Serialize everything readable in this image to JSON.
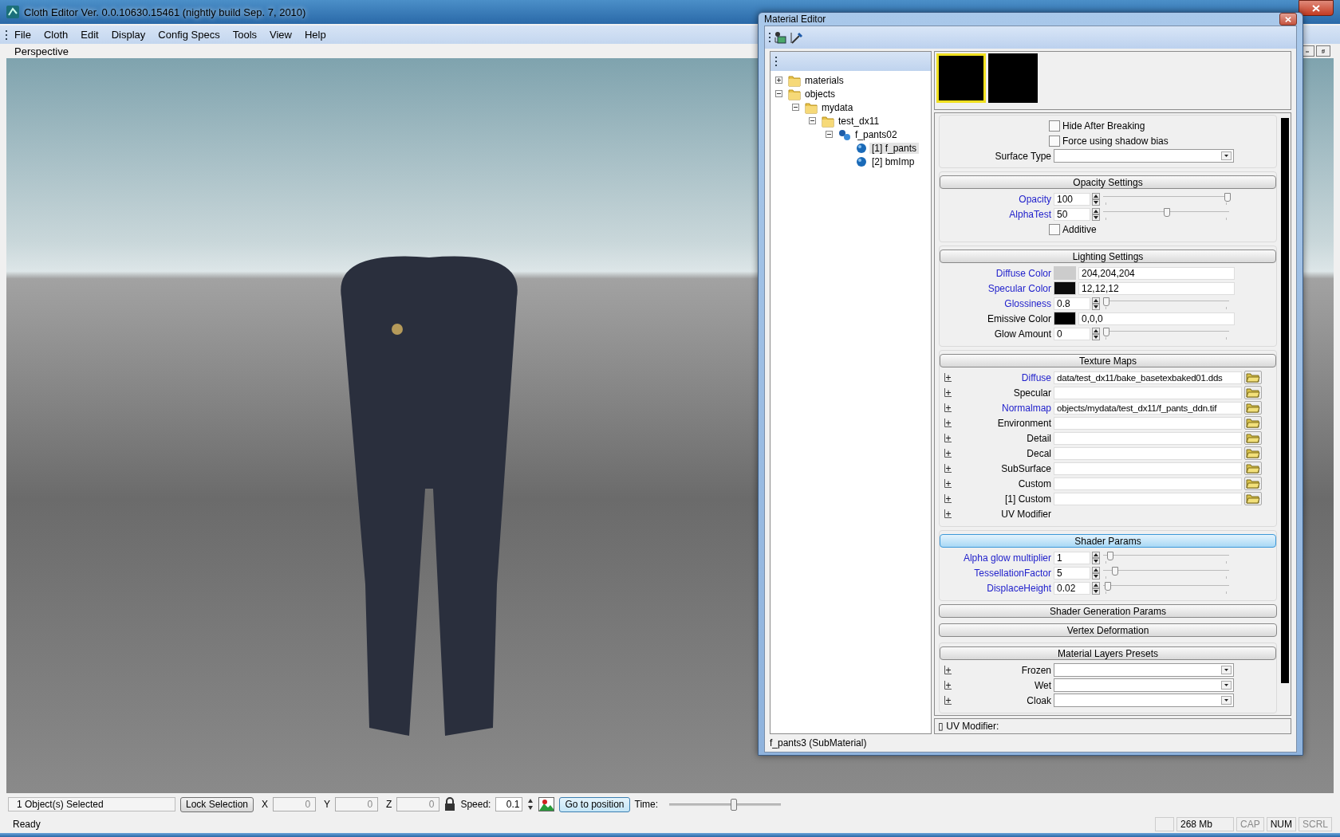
{
  "window": {
    "title": "Cloth Editor Ver. 0.0.10630.15461 (nightly build Sep. 7, 2010)"
  },
  "menu": [
    "File",
    "Cloth",
    "Edit",
    "Display",
    "Config Specs",
    "Tools",
    "View",
    "Help"
  ],
  "viewport": {
    "label": "Perspective"
  },
  "bottom_toolbar": {
    "selection": "1 Object(s) Selected",
    "lock_button": "Lock Selection",
    "coords": [
      {
        "label": "X",
        "value": "0",
        "disabled": true
      },
      {
        "label": "Y",
        "value": "0",
        "disabled": true
      },
      {
        "label": "Z",
        "value": "0",
        "disabled": true
      }
    ],
    "speed_label": "Speed:",
    "speed": "0.1",
    "goto_button": "Go to position",
    "time_label": "Time:",
    "time_slider": {
      "level": 0.57
    }
  },
  "status_bar": {
    "text": "Ready",
    "memory": "268 Mb",
    "indicators": [
      {
        "label": "CAP",
        "on": false
      },
      {
        "label": "NUM",
        "on": true
      },
      {
        "label": "SCRL",
        "on": false
      }
    ]
  },
  "material_editor": {
    "title": "Material Editor",
    "tree": [
      {
        "label": "materials",
        "kind": "folder",
        "expanded": false,
        "selected": false
      },
      {
        "label": "objects",
        "kind": "folder",
        "expanded": true,
        "selected": false,
        "children": [
          {
            "label": "mydata",
            "kind": "folder",
            "expanded": true,
            "selected": false,
            "children": [
              {
                "label": "test_dx11",
                "kind": "folder",
                "expanded": true,
                "selected": false,
                "children": [
                  {
                    "label": "f_pants02",
                    "kind": "object",
                    "expanded": true,
                    "selected": false,
                    "children": [
                      {
                        "label": "[1] f_pants",
                        "kind": "material",
                        "selected": true
                      },
                      {
                        "label": "[2] bmImp",
                        "kind": "material",
                        "selected": false
                      }
                    ]
                  }
                ]
              }
            ]
          }
        ]
      }
    ],
    "previews": [
      {
        "selected": true
      },
      {
        "selected": false
      }
    ],
    "rows": [
      {
        "kind": "checkbox",
        "label": "Hide After Breaking",
        "checked": false
      },
      {
        "kind": "checkbox",
        "label": "Force using shadow bias",
        "checked": false
      },
      {
        "kind": "combo",
        "label": "Surface Type",
        "emphasized": false
      }
    ],
    "sections": [
      {
        "title": "Opacity Settings",
        "selected": false,
        "rows": [
          {
            "kind": "spin",
            "label": "Opacity",
            "emphasized": true,
            "value": "100",
            "level": 1.0
          },
          {
            "kind": "spin",
            "label": "AlphaTest",
            "emphasized": true,
            "value": "50",
            "level": 0.5
          },
          {
            "kind": "checkbox",
            "label": "Additive",
            "checked": false
          }
        ]
      },
      {
        "title": "Lighting Settings",
        "selected": false,
        "rows": [
          {
            "kind": "color",
            "label": "Diffuse Color",
            "emphasized": true,
            "color": "#cccccc",
            "value": "204,204,204"
          },
          {
            "kind": "color",
            "label": "Specular Color",
            "emphasized": true,
            "color": "#0c0c0c",
            "value": "12,12,12"
          },
          {
            "kind": "spin",
            "label": "Glossiness",
            "emphasized": true,
            "value": "0.8",
            "level": 0.0
          },
          {
            "kind": "color",
            "label": "Emissive Color",
            "emphasized": false,
            "color": "#000000",
            "value": "0,0,0"
          },
          {
            "kind": "spin",
            "label": "Glow Amount",
            "emphasized": false,
            "value": "0",
            "level": 0.0
          }
        ]
      },
      {
        "title": "Texture Maps",
        "selected": false,
        "rows": [
          {
            "kind": "file",
            "label": "Diffuse",
            "emphasized": true,
            "expanded": false,
            "value": "data/test_dx11/bake_basetexbaked01.dds"
          },
          {
            "kind": "file",
            "label": "Specular",
            "emphasized": false,
            "expanded": false
          },
          {
            "kind": "file",
            "label": "Normalmap",
            "emphasized": true,
            "expanded": false,
            "value": "objects/mydata/test_dx11/f_pants_ddn.tif"
          },
          {
            "kind": "file",
            "label": "Environment",
            "emphasized": false,
            "expanded": false
          },
          {
            "kind": "file",
            "label": "Detail",
            "emphasized": false,
            "expanded": false
          },
          {
            "kind": "file",
            "label": "Decal",
            "emphasized": false,
            "expanded": false
          },
          {
            "kind": "file",
            "label": "SubSurface",
            "emphasized": false,
            "expanded": false
          },
          {
            "kind": "file",
            "label": "Custom",
            "emphasized": false,
            "expanded": false
          },
          {
            "kind": "file",
            "label": "[1] Custom",
            "emphasized": false,
            "expanded": false
          },
          {
            "kind": "label",
            "label": "UV Modifier",
            "emphasized": false,
            "expanded": false
          }
        ]
      },
      {
        "title": "Shader Params",
        "selected": true,
        "rows": [
          {
            "kind": "spin",
            "label": "Alpha glow multiplier",
            "emphasized": true,
            "value": "1",
            "level": 0.03
          },
          {
            "kind": "spin",
            "label": "TessellationFactor",
            "emphasized": true,
            "value": "5",
            "level": 0.07
          },
          {
            "kind": "spin",
            "label": "DisplaceHeight",
            "emphasized": true,
            "value": "0.02",
            "level": 0.01
          }
        ]
      },
      {
        "title": "Shader Generation Params",
        "selected": false
      },
      {
        "title": "Vertex Deformation",
        "selected": false
      },
      {
        "title": "Material Layers Presets",
        "selected": false,
        "rows": [
          {
            "kind": "combo",
            "label": "Frozen",
            "emphasized": false,
            "expanded": false
          },
          {
            "kind": "combo",
            "label": "Wet",
            "emphasized": false,
            "expanded": false
          },
          {
            "kind": "combo",
            "label": "Cloak",
            "emphasized": false,
            "expanded": false
          }
        ]
      }
    ],
    "footer": "▯ UV Modifier:",
    "status": "f_pants3 (SubMaterial)"
  }
}
